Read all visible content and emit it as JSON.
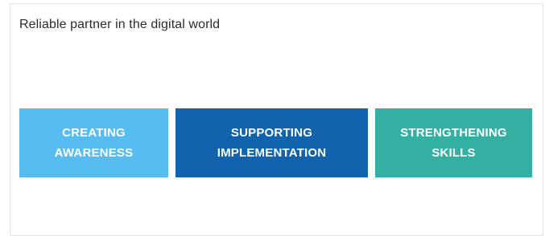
{
  "heading": "Reliable partner in the digital world",
  "pillars": [
    {
      "label": "CREATING\nAWARENESS",
      "color": "#57bdf0"
    },
    {
      "label": "SUPPORTING\nIMPLEMENTATION",
      "color": "#1163ad"
    },
    {
      "label": "STRENGTHENING\nSKILLS",
      "color": "#33b0a1"
    }
  ],
  "colors": {
    "background": "#ffffff",
    "border": "#e3e3e3",
    "heading_text": "#2b2b2b",
    "pillar_text": "#ffffff"
  }
}
